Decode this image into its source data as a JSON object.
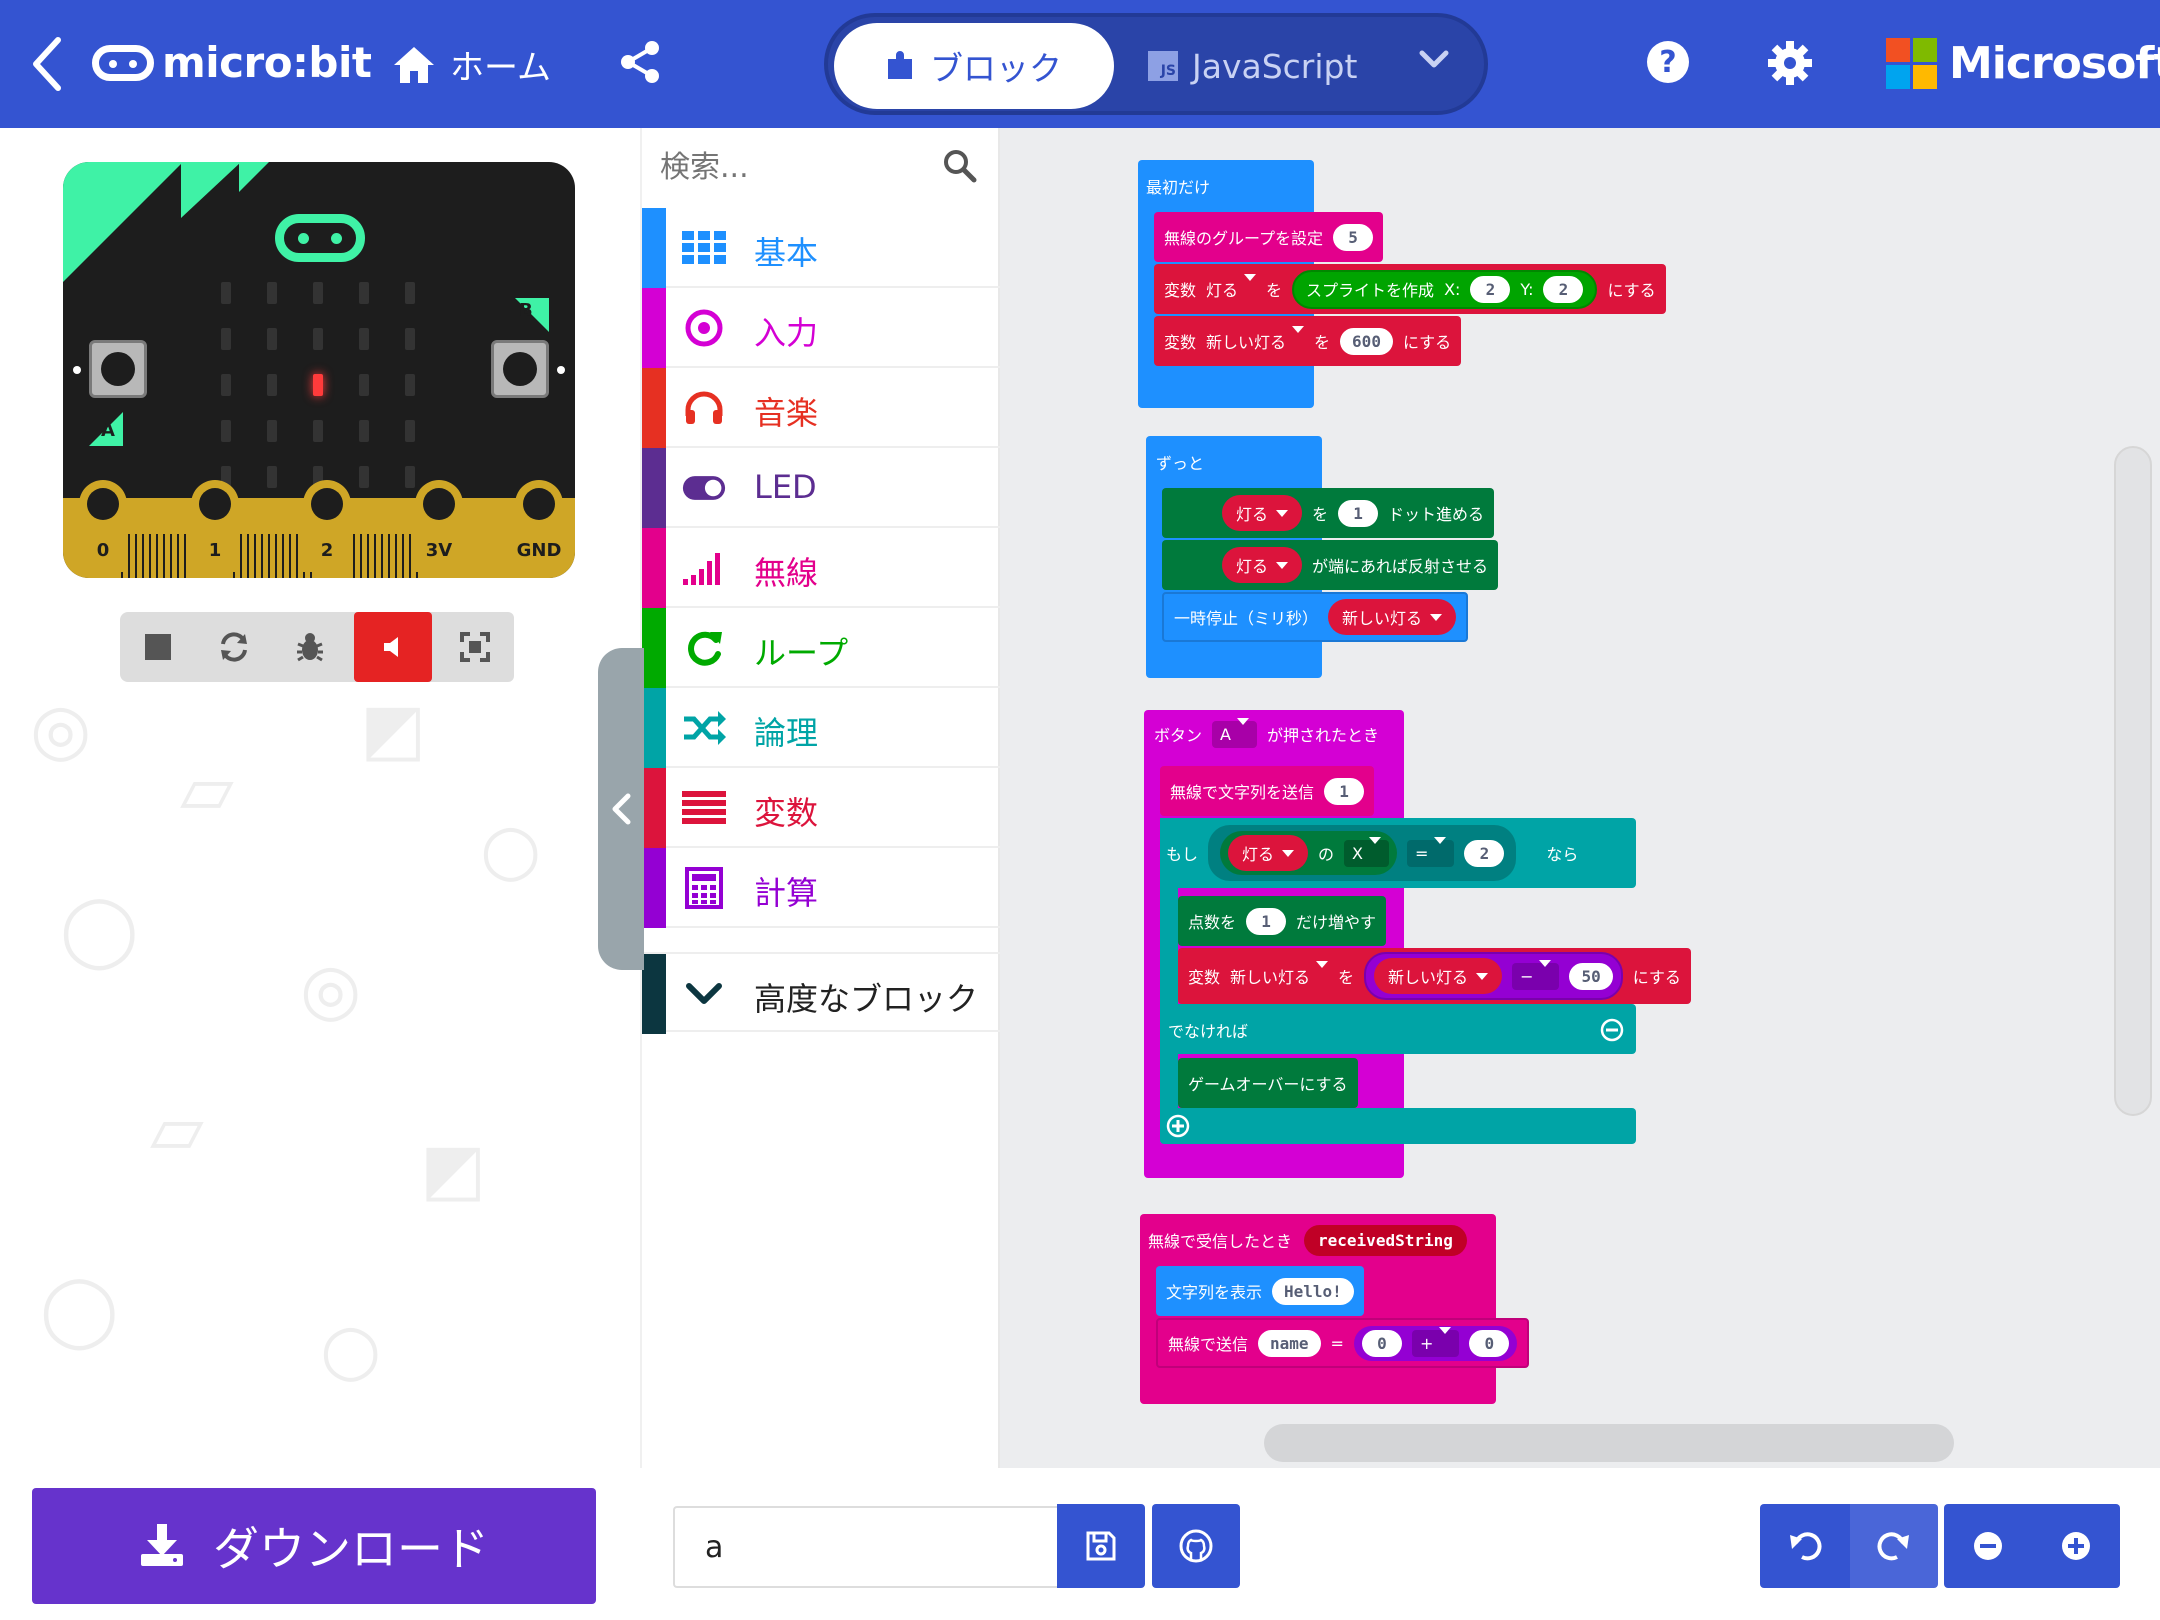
{
  "header": {
    "logo_text": "micro:bit",
    "home_label": "ホーム",
    "blocks_tab_label": "ブロック",
    "js_tab_label": "JavaScript",
    "js_icon_text": "JS",
    "brand": "Microsoft",
    "brand_colors": [
      "#f25022",
      "#7fba00",
      "#00a4ef",
      "#ffb900"
    ]
  },
  "simulator": {
    "button_a": "A",
    "button_b": "B",
    "pins": [
      "0",
      "1",
      "2",
      "3V",
      "GND"
    ],
    "lit_led": {
      "row": 2,
      "col": 2
    },
    "led_color": "#ff3b3b"
  },
  "toolbox": {
    "search_placeholder": "検索...",
    "categories": [
      {
        "label": "基本",
        "color": "#1e90ff",
        "icon": "grid-icon"
      },
      {
        "label": "入力",
        "color": "#d400d4",
        "icon": "target-icon"
      },
      {
        "label": "音楽",
        "color": "#e63022",
        "icon": "headphones-icon"
      },
      {
        "label": "LED",
        "color": "#5c2d91",
        "icon": "toggle-icon"
      },
      {
        "label": "無線",
        "color": "#e3008c",
        "icon": "signal-icon"
      },
      {
        "label": "ループ",
        "color": "#00aa00",
        "icon": "loop-icon"
      },
      {
        "label": "論理",
        "color": "#00a4a6",
        "icon": "shuffle-icon"
      },
      {
        "label": "変数",
        "color": "#dc143c",
        "icon": "list-icon"
      },
      {
        "label": "計算",
        "color": "#9400d3",
        "icon": "calculator-icon"
      },
      {
        "label": "高度なブロック",
        "color": "#0c3640",
        "icon": "chevron-down-icon"
      }
    ]
  },
  "blocks": {
    "on_start": {
      "hat": "最初だけ",
      "set_group": "無線のグループを設定",
      "group_value": "5",
      "var_kw": "変数",
      "var1": "灯る",
      "wo": "を",
      "create_sprite": "スプライトを作成",
      "x_label": "X:",
      "x_val": "2",
      "y_label": "Y:",
      "y_val": "2",
      "suru": "にする",
      "var2": "新しい灯る",
      "var2_val": "600"
    },
    "forever": {
      "hat": "ずっと",
      "sprite": "灯る",
      "wo": "を",
      "move_val": "1",
      "move_text": "ドット進める",
      "bounce_text": "が端にあれば反射させる",
      "pause_text": "一時停止（ミリ秒）",
      "pause_var": "新しい灯る"
    },
    "on_button": {
      "hat_pre": "ボタン",
      "button": "A",
      "hat_post": "が押されたとき",
      "send_string": "無線で文字列を送信",
      "send_val": "1",
      "if_kw": "もし",
      "sprite": "灯る",
      "no": "の",
      "prop": "X",
      "op": "=",
      "cmp_val": "2",
      "then_kw": "なら",
      "score_text": "点数を",
      "score_val": "1",
      "score_post": "だけ増やす",
      "var_kw": "変数",
      "var": "新しい灯る",
      "wo": "を",
      "minus_var": "新しい灯る",
      "minus_op": "−",
      "minus_val": "50",
      "suru": "にする",
      "else_kw": "でなければ",
      "game_over": "ゲームオーバーにする"
    },
    "on_received": {
      "hat": "無線で受信したとき",
      "param": "receivedString",
      "show_string": "文字列を表示",
      "hello": "Hello!",
      "send_value": "無線で送信",
      "name": "name",
      "eq": "=",
      "a": "0",
      "plus": "+",
      "b": "0"
    }
  },
  "footer": {
    "download_label": "ダウンロード",
    "project_name": "a"
  }
}
